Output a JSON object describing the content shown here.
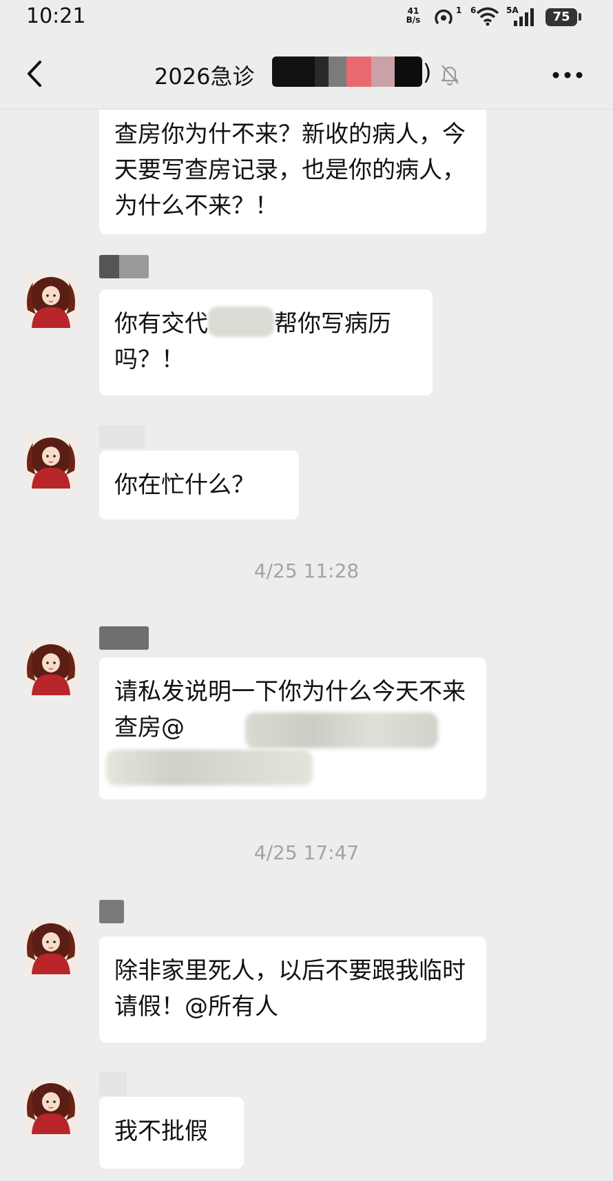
{
  "status_bar": {
    "time": "10:21",
    "net_speed_value": "41",
    "net_speed_unit": "B/s",
    "hotspot_sup": "1",
    "wifi_sup": "6",
    "signal_label": "5A",
    "battery_level": "75"
  },
  "header": {
    "title": "2026急诊",
    "title_close_paren": ")",
    "back_icon": "chevron-left-icon",
    "mute_icon": "bell-muted-icon",
    "more_icon": "more-dots-icon"
  },
  "messages": [
    {
      "text": "查房你为什不来？新收的病人，今天要写查房记录，也是你的病人，为什么不来？！"
    },
    {
      "text_before": "你有交代",
      "text_after": "帮你写病历吗？！"
    },
    {
      "text": "你在忙什么？"
    },
    {
      "timestamp": "4/25 11:28"
    },
    {
      "text": "请私发说明一下你为什么今天不来查房@"
    },
    {
      "timestamp": "4/25 17:47"
    },
    {
      "text": "除非家里死人，以后不要跟我临时请假！@所有人"
    },
    {
      "text": "我不批假"
    }
  ],
  "colors": {
    "background": "#ededed",
    "bubble": "#ffffff",
    "timestamp": "#a3a3a3",
    "avatar_hair": "#5a1e14",
    "avatar_sweater": "#b8262a"
  }
}
